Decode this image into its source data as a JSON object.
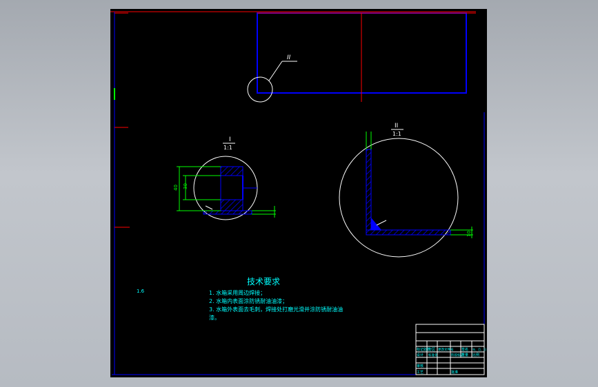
{
  "drawing": {
    "detail_callout_top": "II",
    "detail_I": {
      "label": "I",
      "scale": "1:1",
      "dim_outer": "40",
      "dim_inner": "30"
    },
    "detail_II": {
      "label": "II",
      "scale": "1:1",
      "dim_side": "10"
    },
    "left_marker": "1.6"
  },
  "tech_req": {
    "title": "技术要求",
    "items": [
      "1. 水箱采用周边焊接；",
      "2. 水箱内表面涂防锈耐油油漆；",
      "3. 水箱外表面去毛刺，焊接处打磨光滑并涂防锈耐油油",
      "漆。"
    ]
  },
  "title_block": {
    "row1": [
      "标记处数",
      "分区",
      "更改文件号",
      "签名",
      "年、月、日"
    ],
    "row2": [
      "设计",
      "标准化",
      "阶段标记",
      "重量",
      "比例"
    ],
    "row3": [
      "审核",
      "",
      "",
      "",
      ""
    ],
    "row4": [
      "工艺",
      "批准",
      "",
      "",
      ""
    ]
  },
  "colors": {
    "frame": "#0000ff",
    "geometry": "#ffffff",
    "dimension": "#00ff00",
    "text": "#00ffff",
    "hatch": "#0000ff",
    "axis": "#ff0000",
    "leader": "#ffffff"
  }
}
